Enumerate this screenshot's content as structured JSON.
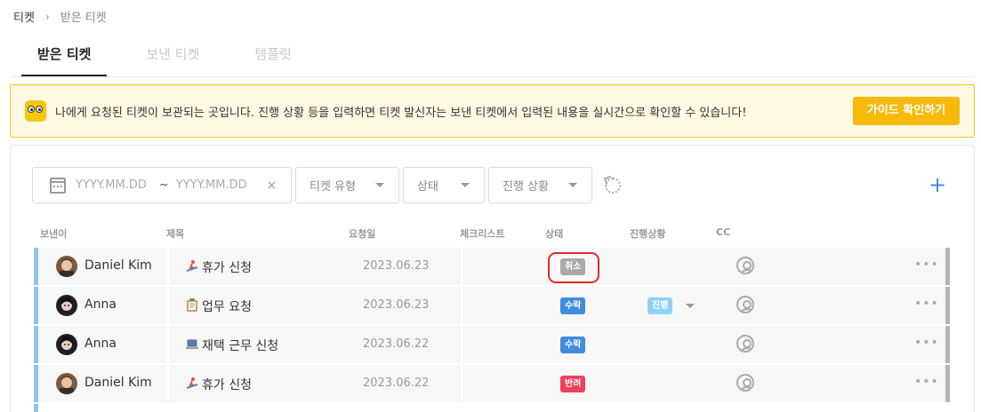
{
  "breadcrumb": {
    "root": "티켓",
    "separator": "›",
    "current": "받은 티켓"
  },
  "tabs": [
    {
      "label": "받은 티켓",
      "active": true
    },
    {
      "label": "보낸 티켓",
      "active": false
    },
    {
      "label": "템플릿",
      "active": false
    }
  ],
  "notice": {
    "icon": "eyes-mascot-icon",
    "text": "나에게 요청된 티켓이 보관되는 곳입니다. 진행 상황 등을 입력하면 티켓 발신자는 보낸 티켓에서 입력된 내용을 실시간으로 확인할 수 있습니다!",
    "button_label": "가이드 확인하기"
  },
  "filters": {
    "date_from_placeholder": "YYYY.MM.DD",
    "date_separator": "~",
    "date_to_placeholder": "YYYY.MM.DD",
    "clear_symbol": "×",
    "type_label": "티켓 유형",
    "status_label": "상태",
    "progress_label": "진행 상황",
    "add_symbol": "+"
  },
  "table": {
    "columns": [
      "보낸이",
      "제목",
      "요청일",
      "체크리스트",
      "상태",
      "진행상황",
      "CC"
    ],
    "rows": [
      {
        "sender": "Daniel Kim",
        "subject_icon": "surfing-icon",
        "subject": "휴가 신청",
        "date": "2023.06.23",
        "status": "취소",
        "status_color": "#a9a9a9",
        "progress": "",
        "more": "•••"
      },
      {
        "sender": "Anna",
        "subject_icon": "clipboard-icon",
        "subject": "업무 요청",
        "date": "2023.06.23",
        "status": "수락",
        "status_color": "#3f8ce0",
        "progress": "진행",
        "more": "•••"
      },
      {
        "sender": "Anna",
        "subject_icon": "laptop-icon",
        "subject": "재택 근무 신청",
        "date": "2023.06.22",
        "status": "수락",
        "status_color": "#3f8ce0",
        "progress": "",
        "more": "•••"
      },
      {
        "sender": "Daniel Kim",
        "subject_icon": "surfing-icon",
        "subject": "휴가 신청",
        "date": "2023.06.22",
        "status": "반려",
        "status_color": "#f0405a",
        "progress": "",
        "more": "•••"
      }
    ]
  },
  "colors": {
    "accent": "#f7b90a",
    "highlight": "#e12a2a",
    "primary": "#3f8ce0"
  }
}
